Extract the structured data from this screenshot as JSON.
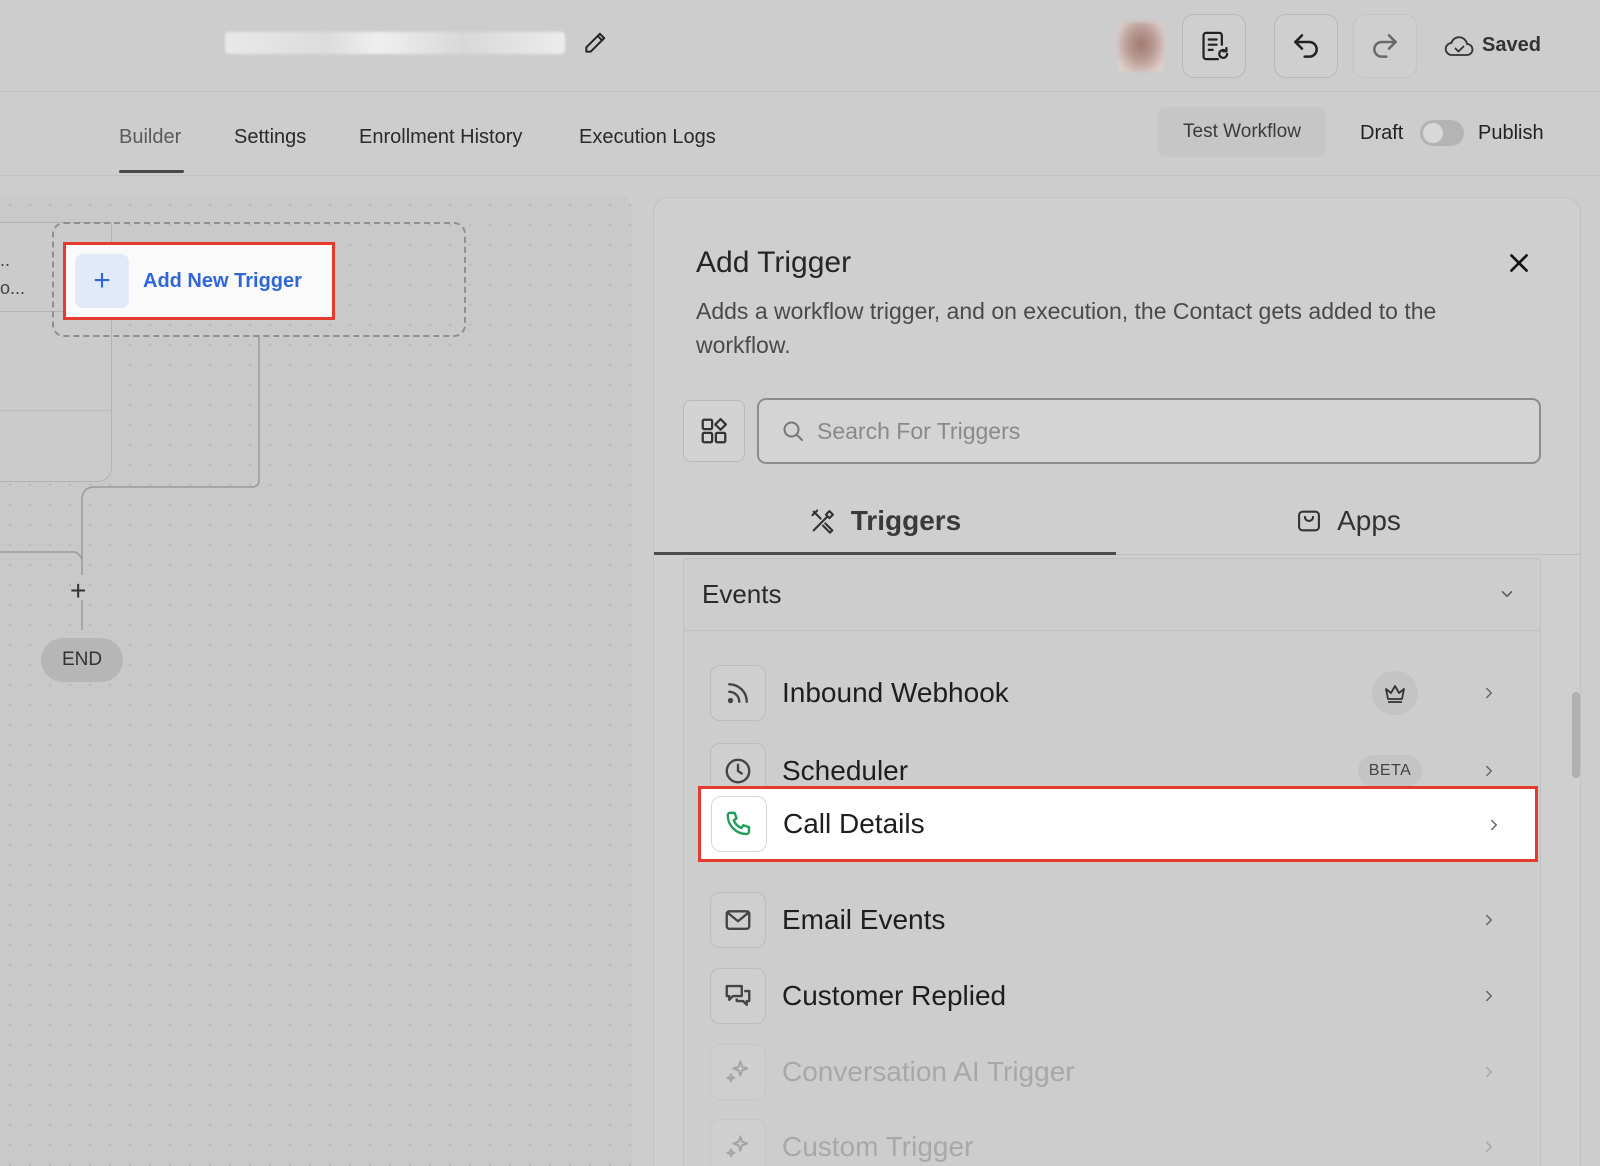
{
  "header": {
    "saved_label": "Saved"
  },
  "nav": {
    "tabs": [
      {
        "label": "Builder",
        "active": true
      },
      {
        "label": "Settings",
        "active": false
      },
      {
        "label": "Enrollment History",
        "active": false
      },
      {
        "label": "Execution Logs",
        "active": false
      }
    ],
    "test_workflow_label": "Test Workflow",
    "draft_label": "Draft",
    "publish_label": "Publish",
    "publish_toggle_on": false
  },
  "canvas": {
    "node_left_lines": [
      "..",
      "o..."
    ],
    "add_trigger_label": "Add New Trigger",
    "add_trigger_icon": "+",
    "add_step_icon": "+",
    "end_label": "END"
  },
  "panel": {
    "title": "Add Trigger",
    "description": "Adds a workflow trigger, and on execution, the Contact gets added to the workflow.",
    "search_placeholder": "Search For Triggers",
    "tabs": [
      {
        "label": "Triggers",
        "icon": "tools-icon",
        "active": true
      },
      {
        "label": "Apps",
        "icon": "app-bag-icon",
        "active": false
      }
    ],
    "section_title": "Events",
    "items": [
      {
        "label": "Inbound Webhook",
        "icon": "webhook-icon",
        "badge": "crown",
        "disabled": false,
        "highlighted": false
      },
      {
        "label": "Scheduler",
        "icon": "clock-icon",
        "badge": "BETA",
        "disabled": false,
        "highlighted": false
      },
      {
        "label": "Call Details",
        "icon": "phone-icon",
        "badge": "",
        "disabled": false,
        "highlighted": true
      },
      {
        "label": "Email Events",
        "icon": "mail-icon",
        "badge": "",
        "disabled": false,
        "highlighted": false
      },
      {
        "label": "Customer Replied",
        "icon": "chat-icon",
        "badge": "",
        "disabled": false,
        "highlighted": false
      },
      {
        "label": "Conversation AI Trigger",
        "icon": "sparkle-icon",
        "badge": "",
        "disabled": true,
        "highlighted": false
      },
      {
        "label": "Custom Trigger",
        "icon": "sparkle-icon",
        "badge": "",
        "disabled": true,
        "highlighted": false
      }
    ]
  },
  "colors": {
    "accent_blue": "#2f67d8",
    "highlight_red": "#e53b2f",
    "phone_green": "#1e9e5a"
  }
}
